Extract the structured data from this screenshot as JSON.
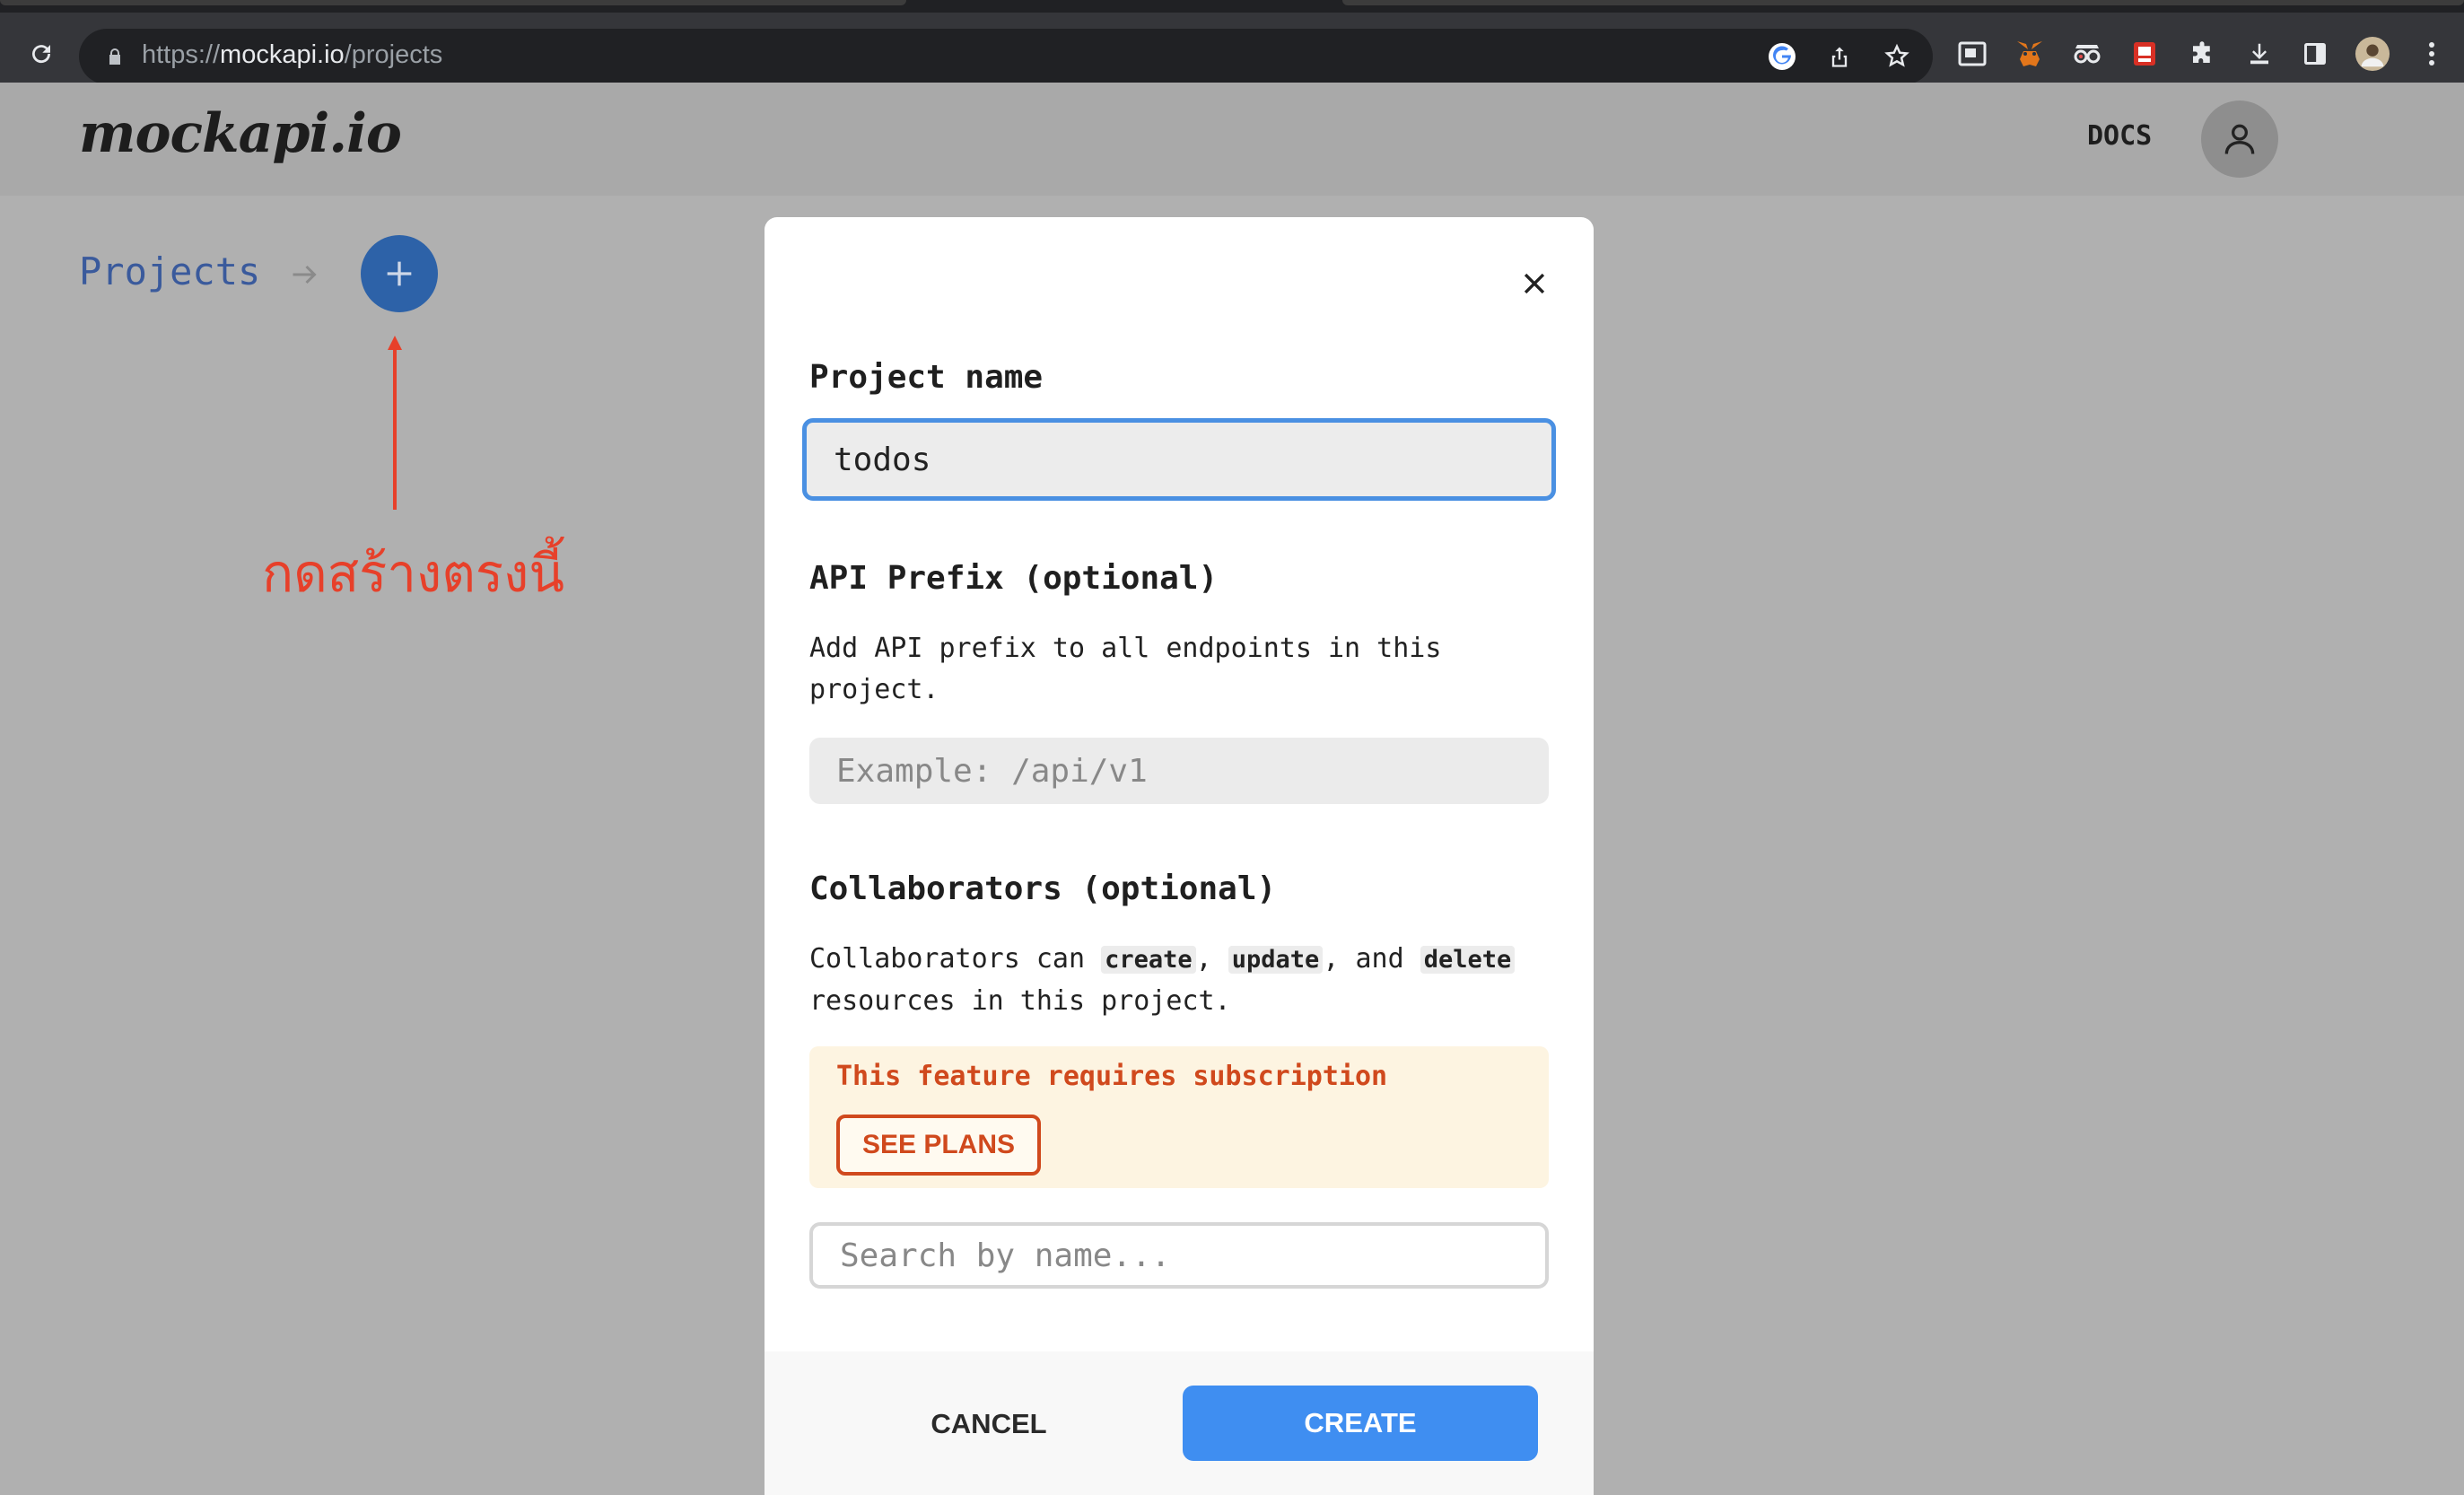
{
  "browser": {
    "url_prefix": "https://",
    "url_host": "mockapi.io",
    "url_path": "/projects"
  },
  "header": {
    "logo": "mockapi.io",
    "docs_label": "DOCS"
  },
  "breadcrumb": {
    "projects_label": "Projects"
  },
  "annotation": {
    "text": "กดสร้างตรงนี้",
    "color": "#e7402a"
  },
  "modal": {
    "project_name_label": "Project name",
    "project_name_value": "todos",
    "api_prefix_label": "API Prefix (optional)",
    "api_prefix_desc": "Add API prefix to all endpoints in this project.",
    "api_prefix_placeholder": "Example: /api/v1",
    "collab_label": "Collaborators (optional)",
    "collab_desc_start": "Collaborators can ",
    "collab_code_create": "create",
    "collab_sep1": ", ",
    "collab_code_update": "update",
    "collab_sep2": ", and ",
    "collab_code_delete": "delete",
    "collab_desc_end": "resources in this project.",
    "subscription_notice": "This feature requires subscription",
    "see_plans_label": "SEE PLANS",
    "search_placeholder": "Search by name...",
    "cancel_label": "CANCEL",
    "create_label": "CREATE"
  },
  "colors": {
    "primary": "#3f8ef1",
    "warning": "#d0491d",
    "overlay": "#b0b0b0"
  }
}
